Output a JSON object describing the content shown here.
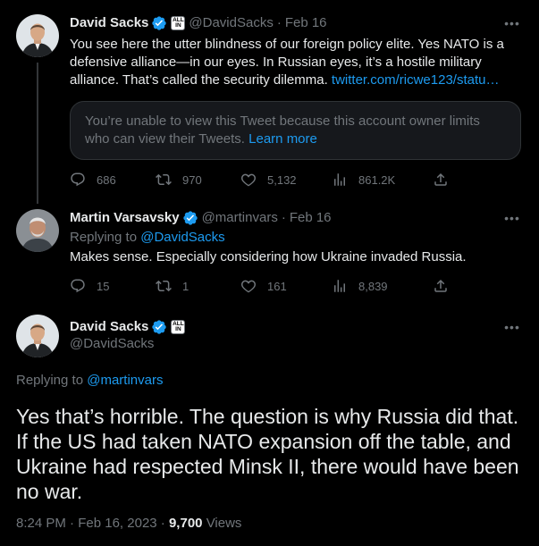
{
  "tweet1": {
    "name": "David Sacks",
    "affiliation": [
      "ALL",
      "IN"
    ],
    "handle": "@DavidSacks",
    "date": "Feb 16",
    "text": "You see here the utter blindness of our foreign policy elite. Yes NATO is a defensive alliance—in our eyes. In Russian eyes, it’s a hostile military alliance. That’s called the security dilemma.",
    "link": "twitter.com/ricwe123/statu…",
    "notice_text": "You’re unable to view this Tweet because this account owner limits who can view their Tweets.",
    "notice_link": "Learn more",
    "replies": "686",
    "retweets": "970",
    "likes": "5,132",
    "views": "861.2K"
  },
  "tweet2": {
    "name": "Martin Varsavsky",
    "handle": "@martinvars",
    "date": "Feb 16",
    "replying_label": "Replying to",
    "replying_to": "@DavidSacks",
    "text": "Makes sense. Especially considering how Ukraine invaded Russia.",
    "replies": "15",
    "retweets": "1",
    "likes": "161",
    "views": "8,839"
  },
  "tweet3": {
    "name": "David Sacks",
    "affiliation": [
      "ALL",
      "IN"
    ],
    "handle": "@DavidSacks",
    "replying_label": "Replying to",
    "replying_to": "@martinvars",
    "text": "Yes that’s horrible. The question is why Russia did that. If the US had taken NATO expansion off the table, and Ukraine had respected Minsk II, there would have been no war.",
    "time": "8:24 PM",
    "date": "Feb 16, 2023",
    "views_count": "9,700",
    "views_label": "Views"
  },
  "separator": "·",
  "more_icon": "•••",
  "colors": {
    "accent": "#1d9bf0",
    "muted": "#71767b",
    "text": "#e7e9ea",
    "bg": "#000000"
  },
  "icons": {
    "reply": "reply-icon",
    "retweet": "retweet-icon",
    "like": "like-icon",
    "views": "views-icon",
    "share": "share-icon",
    "verified": "verified-badge-icon"
  }
}
